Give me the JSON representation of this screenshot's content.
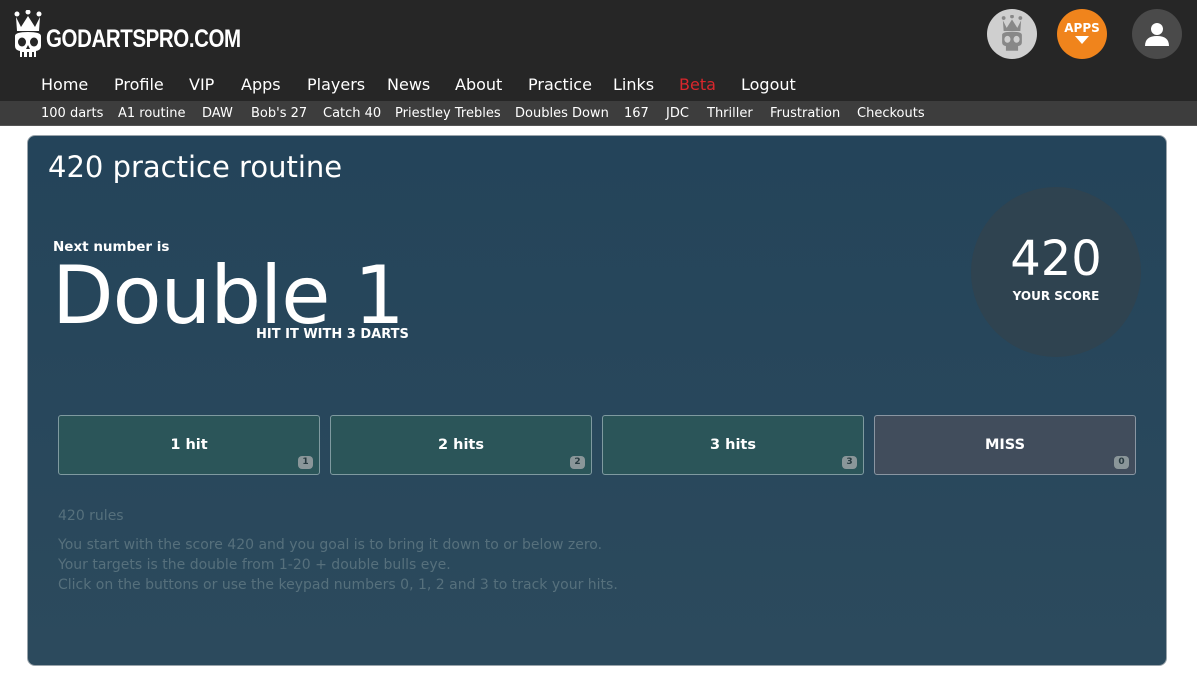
{
  "brand": {
    "name": "GODARTSPRO.COM"
  },
  "header": {
    "icons": {
      "champion": "crowned-skull-icon",
      "apps": "apps-download-icon",
      "user": "user-icon"
    },
    "apps_label": "APPS",
    "colors": {
      "bar": "#262626",
      "apps": "#f0841c",
      "beta": "#d9262c"
    }
  },
  "nav": {
    "main": [
      {
        "label": "Home"
      },
      {
        "label": "Profile"
      },
      {
        "label": "VIP"
      },
      {
        "label": "Apps"
      },
      {
        "label": "Players"
      },
      {
        "label": "News"
      },
      {
        "label": "About"
      },
      {
        "label": "Practice"
      },
      {
        "label": "Links"
      },
      {
        "label": "Beta"
      },
      {
        "label": "Logout"
      }
    ],
    "sub": [
      {
        "label": "100 darts"
      },
      {
        "label": "A1 routine"
      },
      {
        "label": "DAW"
      },
      {
        "label": "Bob's 27"
      },
      {
        "label": "Catch 40"
      },
      {
        "label": "Priestley Trebles"
      },
      {
        "label": "Doubles Down"
      },
      {
        "label": "167"
      },
      {
        "label": "JDC"
      },
      {
        "label": "Thriller"
      },
      {
        "label": "Frustration"
      },
      {
        "label": "Checkouts"
      }
    ]
  },
  "main": {
    "title": "420 practice routine",
    "next_label": "Next number is",
    "next_value": "Double 1",
    "hint": "HIT IT WITH 3 DARTS",
    "score": {
      "value": "420",
      "label": "YOUR SCORE"
    },
    "buttons": [
      {
        "label": "1 hit",
        "key": "1"
      },
      {
        "label": "2 hits",
        "key": "2"
      },
      {
        "label": "3 hits",
        "key": "3"
      },
      {
        "label": "MISS",
        "key": "0"
      }
    ],
    "rules": {
      "title": "420 rules",
      "lines": [
        "You start with the score 420 and you goal is to bring it down to or below zero.",
        "Your targets is the double from 1-20 + double bulls eye.",
        "Click on the buttons or use the keypad numbers 0, 1, 2 and 3 to track your hits."
      ]
    }
  }
}
